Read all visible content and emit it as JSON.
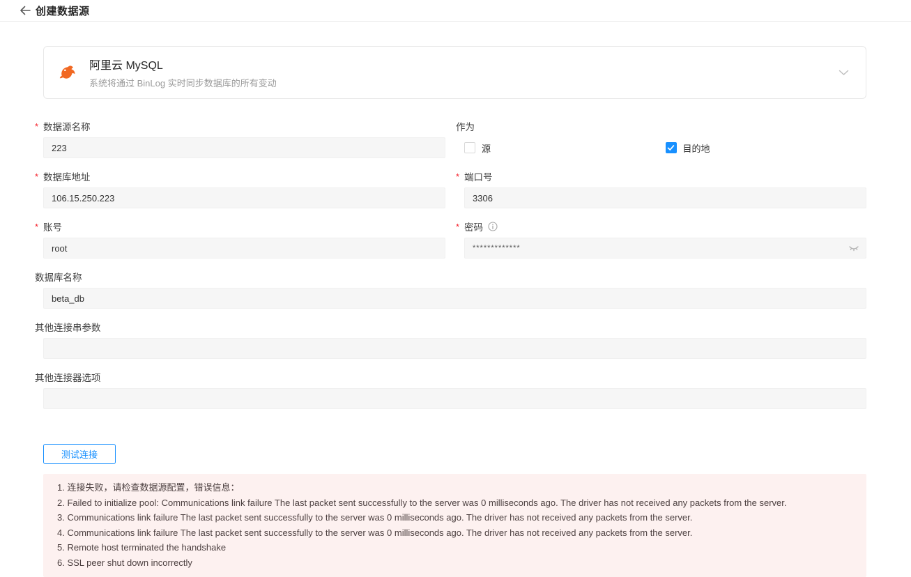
{
  "header": {
    "title": "创建数据源"
  },
  "connector_card": {
    "title": "阿里云 MySQL",
    "subtitle": "系统将通过 BinLog 实时同步数据库的所有变动"
  },
  "form": {
    "required_mark": "*",
    "name": {
      "label": "数据源名称",
      "required": true,
      "value": "223"
    },
    "role": {
      "label": "作为",
      "options": [
        {
          "label": "源",
          "checked": false
        },
        {
          "label": "目的地",
          "checked": true
        }
      ]
    },
    "host": {
      "label": "数据库地址",
      "required": true,
      "value": "106.15.250.223"
    },
    "port": {
      "label": "端口号",
      "required": true,
      "value": "3306"
    },
    "account": {
      "label": "账号",
      "required": true,
      "value": "root"
    },
    "password": {
      "label": "密码",
      "required": true,
      "value": "*************"
    },
    "database": {
      "label": "数据库名称",
      "required": false,
      "value": "beta_db"
    },
    "conn_params": {
      "label": "其他连接串参数",
      "required": false,
      "value": ""
    },
    "connector_options": {
      "label": "其他连接器选项",
      "required": false,
      "value": ""
    },
    "test_button_label": "测试连接"
  },
  "error_panel": {
    "lines": [
      "1. 连接失败，请检查数据源配置，错误信息：",
      "2. Failed to initialize pool: Communications link failure The last packet sent successfully to the server was 0 milliseconds ago. The driver has not received any packets from the server.",
      "3. Communications link failure The last packet sent successfully to the server was 0 milliseconds ago. The driver has not received any packets from the server.",
      "4. Communications link failure The last packet sent successfully to the server was 0 milliseconds ago. The driver has not received any packets from the server.",
      "5. Remote host terminated the handshake",
      "6. SSL peer shut down incorrectly"
    ]
  },
  "colors": {
    "accent_blue": "#1890ff",
    "required_red": "#f5222d",
    "mysql_orange": "#f16822",
    "error_bg": "#fdf1f0",
    "input_bg": "#f6f6f6"
  }
}
